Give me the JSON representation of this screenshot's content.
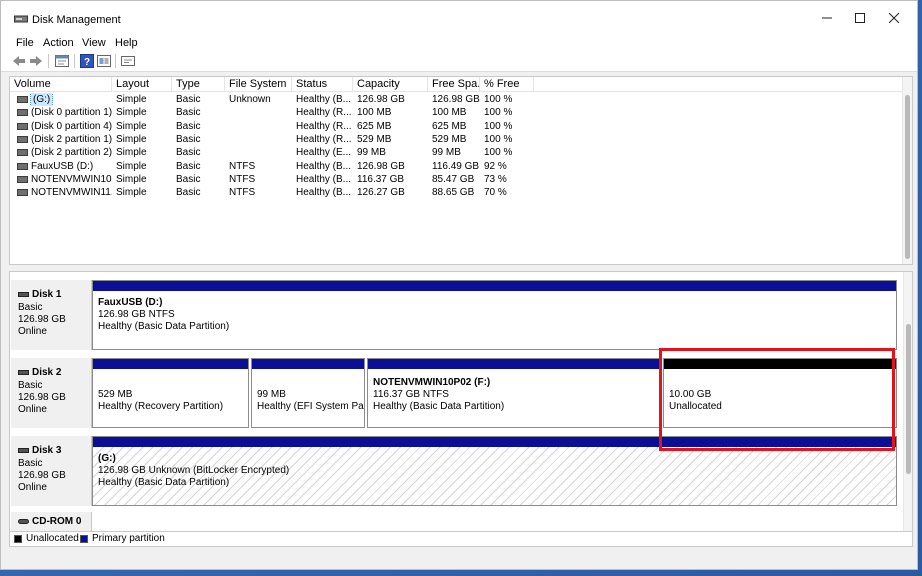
{
  "window": {
    "title": "Disk Management"
  },
  "menu": [
    "File",
    "Action",
    "View",
    "Help"
  ],
  "volume_table": {
    "columns": [
      "Volume",
      "Layout",
      "Type",
      "File System",
      "Status",
      "Capacity",
      "Free Spa...",
      "% Free"
    ],
    "rows": [
      {
        "volume": "(G:)",
        "layout": "Simple",
        "type": "Basic",
        "fs": "Unknown",
        "status": "Healthy (B...",
        "capacity": "126.98 GB",
        "free": "126.98 GB",
        "pct": "100 %"
      },
      {
        "volume": "(Disk 0 partition 1)",
        "layout": "Simple",
        "type": "Basic",
        "fs": "",
        "status": "Healthy (R...",
        "capacity": "100 MB",
        "free": "100 MB",
        "pct": "100 %"
      },
      {
        "volume": "(Disk 0 partition 4)",
        "layout": "Simple",
        "type": "Basic",
        "fs": "",
        "status": "Healthy (R...",
        "capacity": "625 MB",
        "free": "625 MB",
        "pct": "100 %"
      },
      {
        "volume": "(Disk 2 partition 1)",
        "layout": "Simple",
        "type": "Basic",
        "fs": "",
        "status": "Healthy (R...",
        "capacity": "529 MB",
        "free": "529 MB",
        "pct": "100 %"
      },
      {
        "volume": "(Disk 2 partition 2)",
        "layout": "Simple",
        "type": "Basic",
        "fs": "",
        "status": "Healthy (E...",
        "capacity": "99 MB",
        "free": "99 MB",
        "pct": "100 %"
      },
      {
        "volume": "FauxUSB (D:)",
        "layout": "Simple",
        "type": "Basic",
        "fs": "NTFS",
        "status": "Healthy (B...",
        "capacity": "126.98 GB",
        "free": "116.49 GB",
        "pct": "92 %"
      },
      {
        "volume": "NOTENVMWIN10...",
        "layout": "Simple",
        "type": "Basic",
        "fs": "NTFS",
        "status": "Healthy (B...",
        "capacity": "116.37 GB",
        "free": "85.47 GB",
        "pct": "73 %"
      },
      {
        "volume": "NOTENVMWIN11...",
        "layout": "Simple",
        "type": "Basic",
        "fs": "NTFS",
        "status": "Healthy (B...",
        "capacity": "126.27 GB",
        "free": "88.65 GB",
        "pct": "70 %"
      }
    ]
  },
  "disks": {
    "disk1": {
      "name": "Disk 1",
      "type": "Basic",
      "size": "126.98 GB",
      "state": "Online",
      "p1": {
        "label": "FauxUSB  (D:)",
        "size": "126.98 GB NTFS",
        "status": "Healthy (Basic Data Partition)"
      }
    },
    "disk2": {
      "name": "Disk 2",
      "type": "Basic",
      "size": "126.98 GB",
      "state": "Online",
      "p1": {
        "size": "529 MB",
        "status": "Healthy (Recovery Partition)"
      },
      "p2": {
        "size": "99 MB",
        "status": "Healthy (EFI System Parti"
      },
      "p3": {
        "label": "NOTENVMWIN10P02  (F:)",
        "size": "116.37 GB NTFS",
        "status": "Healthy (Basic Data Partition)"
      },
      "p4": {
        "size": "10.00 GB",
        "status": "Unallocated"
      }
    },
    "disk3": {
      "name": "Disk 3",
      "type": "Basic",
      "size": "126.98 GB",
      "state": "Online",
      "p1": {
        "label": "(G:)",
        "size": "126.98 GB Unknown (BitLocker Encrypted)",
        "status": "Healthy (Basic Data Partition)"
      }
    },
    "cdrom": {
      "name": "CD-ROM 0"
    }
  },
  "legend": {
    "unallocated": "Unallocated",
    "primary": "Primary partition"
  },
  "colors": {
    "primary_bar": "#0a0f96",
    "unallocated_bar": "#000000",
    "highlight": "#e4121a"
  },
  "icons": [
    "disk-management-icon",
    "back-arrow-icon",
    "forward-arrow-icon",
    "properties-icon",
    "help-icon",
    "refresh-icon",
    "console-icon"
  ]
}
